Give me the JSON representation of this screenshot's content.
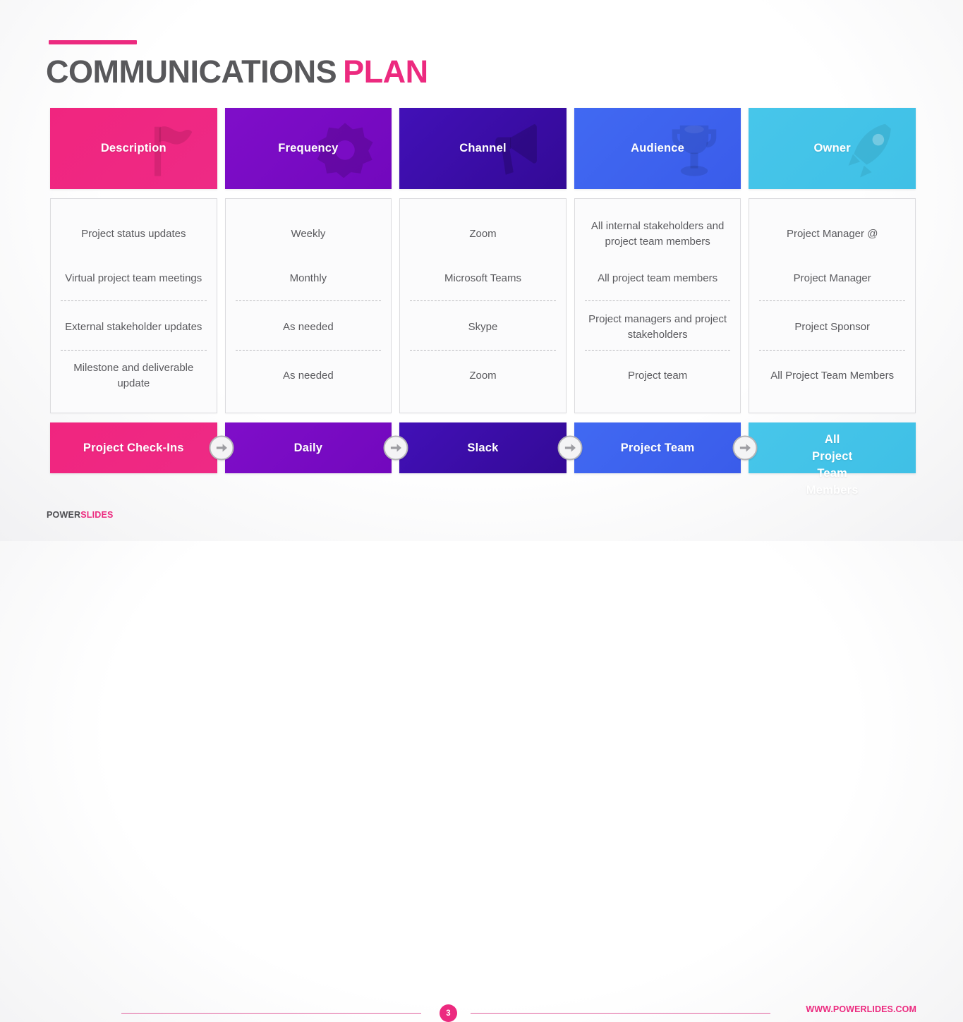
{
  "title": {
    "part1": "COMMUNICATIONS",
    "part2": "PLAN"
  },
  "colors": {
    "pink": "#ec2a7f",
    "purple": "#7a0cc4",
    "indigo": "#3a0ca8",
    "blue": "#3f63ef",
    "cyan": "#44c3e8",
    "title_dark": "#58585b",
    "body_text": "#5a5a5e"
  },
  "columns": [
    {
      "header": "Description",
      "icon": "flag-icon",
      "color": "#ec2a7f",
      "cells": [
        "Project status updates",
        "Virtual project team meetings",
        "External stakeholder updates",
        "Milestone and deliverable update"
      ],
      "strip": "Project Check-Ins"
    },
    {
      "header": "Frequency",
      "icon": "gear-icon",
      "color": "#7a0cc4",
      "cells": [
        "Weekly",
        "Monthly",
        "As needed",
        "As needed"
      ],
      "strip": "Daily"
    },
    {
      "header": "Channel",
      "icon": "megaphone-icon",
      "color": "#3a0ca8",
      "cells": [
        "Zoom",
        "Microsoft Teams",
        "Skype",
        "Zoom"
      ],
      "strip": "Slack"
    },
    {
      "header": "Audience",
      "icon": "trophy-icon",
      "color": "#3f63ef",
      "cells": [
        "All internal stakeholders and project team members",
        "All project team members",
        "Project managers and project stakeholders",
        "Project team"
      ],
      "strip": "Project Team"
    },
    {
      "header": "Owner",
      "icon": "rocket-icon",
      "color": "#44c3e8",
      "cells": [
        "Project Manager @",
        "Project Manager",
        "Project Sponsor",
        "All Project Team Members"
      ],
      "strip": "All Project Team Members"
    }
  ],
  "arrow_icon": "arrow-right-icon",
  "footer": {
    "brand_part1": "POWER",
    "brand_part2": "SLIDES",
    "page_number": "3",
    "url": "WWW.POWERLIDES.COM"
  }
}
